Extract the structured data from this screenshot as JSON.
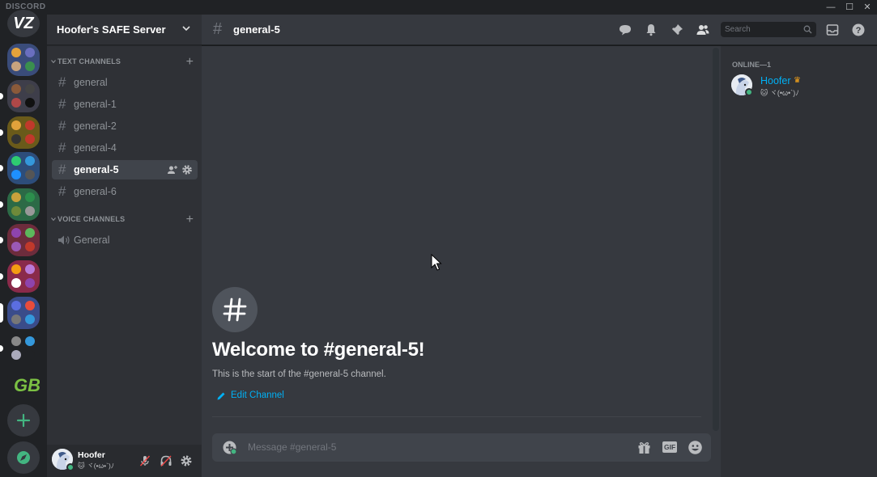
{
  "app": {
    "brand": "DISCORD",
    "window_controls": [
      "—",
      "☐",
      "✕"
    ]
  },
  "rail": {
    "home_label": "VZ",
    "servers": [
      {
        "colors": [
          "#e5a33b",
          "#6a6fbf",
          "#c7a37e",
          "#3a8f4e"
        ],
        "unread": false
      },
      {
        "colors": [
          "#8a5a3a",
          "#444",
          "#b04848",
          "#111"
        ],
        "unread": true
      },
      {
        "colors": [
          "#e2a23b",
          "#c0392b",
          "#333",
          "#c0392b"
        ],
        "unread": true
      },
      {
        "colors": [
          "#2ecc71",
          "#3498db",
          "#1e90ff",
          "#555"
        ],
        "unread": true
      },
      {
        "colors": [
          "#c8a23c",
          "#2c8f4c",
          "#6f8a3a",
          "#999"
        ],
        "unread": true
      },
      {
        "colors": [
          "#8e44ad",
          "#5cb85c",
          "#9b59b6",
          "#c0392b"
        ],
        "unread": true
      },
      {
        "colors": [
          "#f39c12",
          "#b97ad8",
          "#fff",
          "#8e44ad"
        ],
        "unread": true
      },
      {
        "colors": [
          "#5b6ee1",
          "#e74c3c",
          "#777",
          "#3498db"
        ],
        "unread": true,
        "selected": true
      },
      {
        "colors": [
          "#888",
          "#3498db",
          "#aab",
          "#202225"
        ],
        "unread": true
      }
    ],
    "special_server_label": "GB",
    "add_label": "+",
    "explore_label": "explore"
  },
  "sidebar": {
    "server_name": "Hoofer's SAFE Server",
    "text_category": "Text Channels",
    "voice_category": "Voice Channels",
    "text_channels": [
      "general",
      "general-1",
      "general-2",
      "general-4",
      "general-5",
      "general-6"
    ],
    "active_channel_index": 4,
    "voice_channels": [
      "General"
    ]
  },
  "user": {
    "name": "Hoofer",
    "status_text": "🐱 ヾ(•ω•`)ﾉ"
  },
  "header": {
    "channel_name": "general-5",
    "search_placeholder": "Search"
  },
  "welcome": {
    "title": "Welcome to #general-5!",
    "subtitle": "This is the start of the #general-5 channel.",
    "edit_label": "Edit Channel"
  },
  "composer": {
    "placeholder": "Message #general-5",
    "gif_label": "GIF"
  },
  "members": {
    "heading": "Online—1",
    "list": [
      {
        "name": "Hoofer",
        "activity": "🐱 ヾ(•ω•`)ﾉ",
        "owner": true
      }
    ]
  },
  "colors": {
    "accent": "#7289da",
    "link": "#00b0f4",
    "online": "#43b581",
    "crown": "#faa61a"
  }
}
